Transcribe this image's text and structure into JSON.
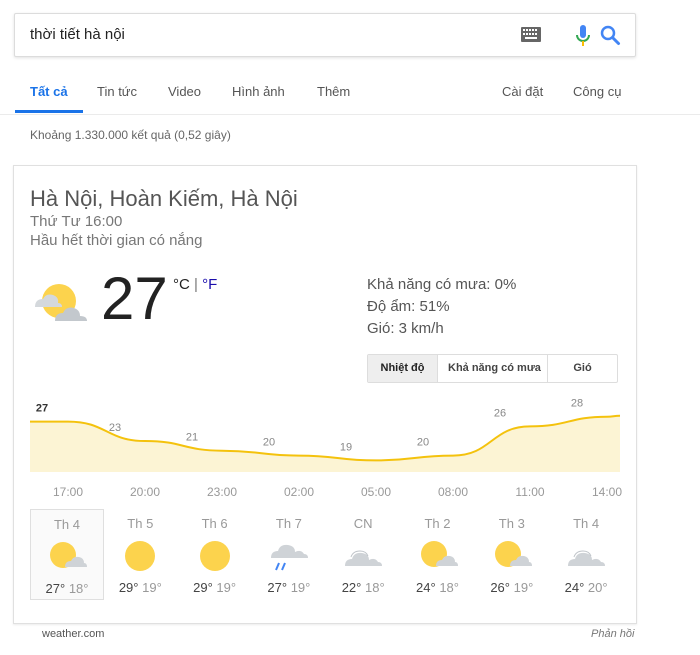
{
  "search": {
    "query": "thời tiết hà nội"
  },
  "icons": {
    "keyboard": "keyboard-icon",
    "mic": "microphone-icon",
    "search": "search-icon"
  },
  "colors": {
    "accent": "#1a73e8",
    "chart_line": "#f4c20d",
    "chart_fill": "#fcf4d4",
    "sun": "#fcd34d",
    "cloud": "#cfd3d7",
    "rain": "#4285f4"
  },
  "tabs": {
    "all": "Tất cả",
    "news": "Tin tức",
    "video": "Video",
    "images": "Hình ảnh",
    "more": "Thêm",
    "settings": "Cài đặt",
    "tools": "Công cụ"
  },
  "results": {
    "count": "Khoảng 1.330.000 kết quả (0,52 giây)"
  },
  "weather": {
    "location": "Hà Nội, Hoàn Kiếm, Hà Nội",
    "time": "Thứ Tư 16:00",
    "condition": "Hầu hết thời gian có nắng",
    "current_icon": "partly-sunny-icon",
    "temp": "27",
    "unit_c": "°C",
    "unit_sep": "|",
    "unit_f": "°F",
    "precip": "Khả năng có mưa: 0%",
    "humidity": "Độ ẩm: 51%",
    "wind": "Gió: 3 km/h",
    "chart_tabs": {
      "temp": "Nhiệt độ",
      "precip": "Khả năng có mưa",
      "wind": "Gió"
    },
    "source": "weather.com",
    "feedback": "Phản hồi",
    "days": [
      {
        "name": "Th 4",
        "hi": "27°",
        "lo": "18°",
        "icon": "partly-sunny-icon"
      },
      {
        "name": "Th 5",
        "hi": "29°",
        "lo": "19°",
        "icon": "sunny-icon"
      },
      {
        "name": "Th 6",
        "hi": "29°",
        "lo": "19°",
        "icon": "sunny-icon"
      },
      {
        "name": "Th 7",
        "hi": "27°",
        "lo": "19°",
        "icon": "rain-icon"
      },
      {
        "name": "CN",
        "hi": "22°",
        "lo": "18°",
        "icon": "cloudy-icon"
      },
      {
        "name": "Th 2",
        "hi": "24°",
        "lo": "18°",
        "icon": "partly-sunny-icon"
      },
      {
        "name": "Th 3",
        "hi": "26°",
        "lo": "19°",
        "icon": "partly-sunny-icon"
      },
      {
        "name": "Th 4",
        "hi": "24°",
        "lo": "20°",
        "icon": "cloudy-icon"
      }
    ]
  },
  "chart_data": {
    "type": "area",
    "x": [
      "17:00",
      "20:00",
      "23:00",
      "02:00",
      "05:00",
      "08:00",
      "11:00",
      "14:00"
    ],
    "values": [
      27,
      23,
      21,
      20,
      19,
      20,
      26,
      28
    ],
    "ylim": [
      16,
      30
    ]
  }
}
